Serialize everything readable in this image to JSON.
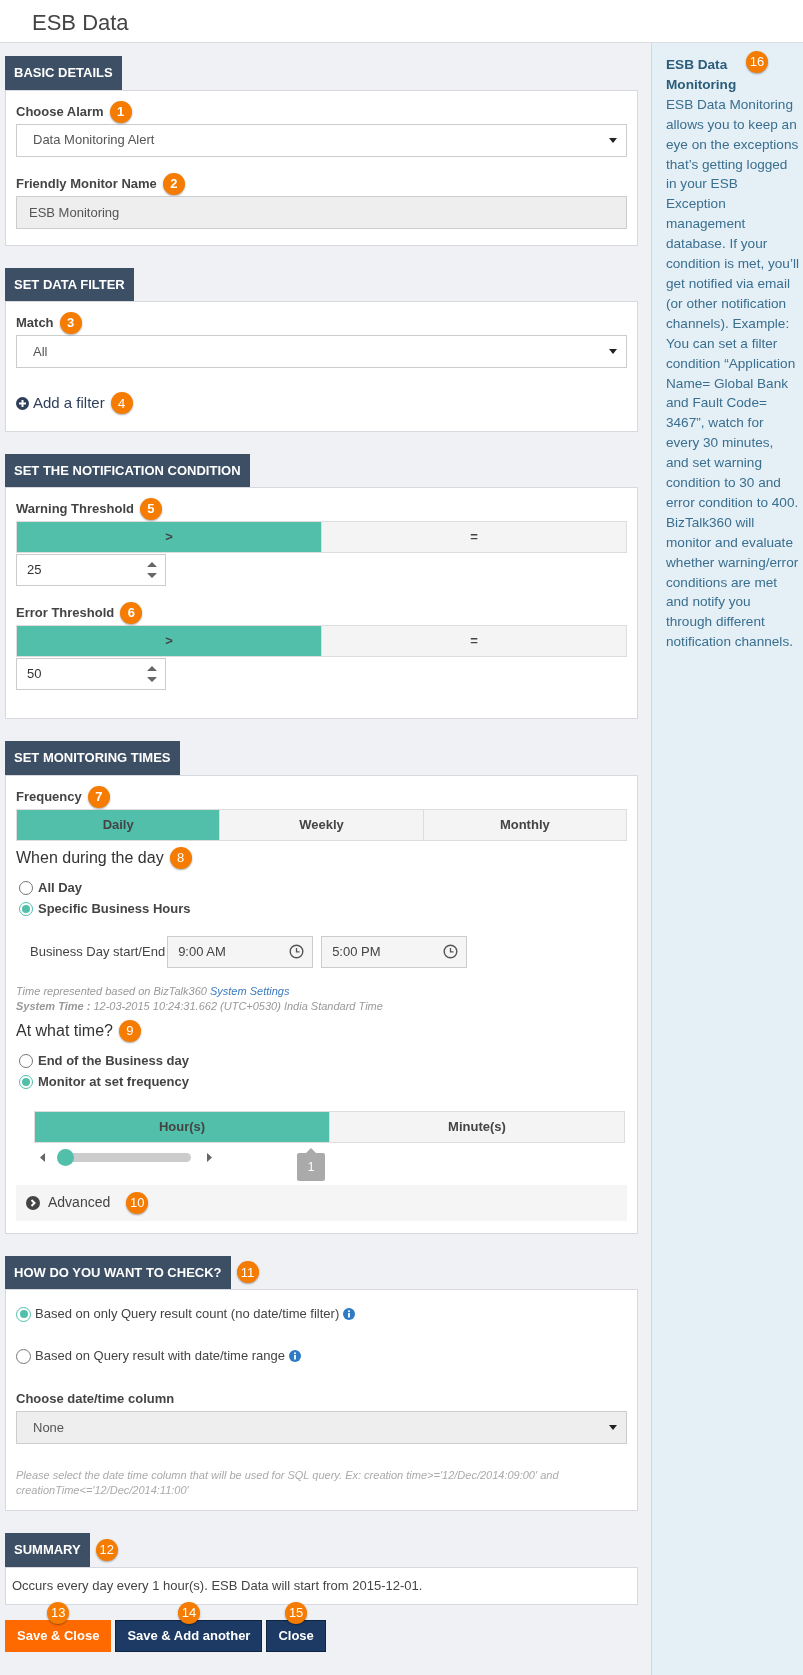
{
  "header": {
    "title": "ESB Data"
  },
  "sections": [
    {
      "title": "BASIC DETAILS",
      "items": [
        {
          "kind": "select",
          "label": "Choose Alarm",
          "badge": "1",
          "value": "Data Monitoring Alert",
          "disabled": false
        },
        {
          "kind": "input",
          "label": "Friendly Monitor Name",
          "badge": "2",
          "value": "ESB Monitoring",
          "disabled": true
        }
      ]
    },
    {
      "title": "SET DATA FILTER",
      "items": [
        {
          "kind": "select",
          "label": "Match",
          "badge": "3",
          "value": "All",
          "disabled": false
        },
        {
          "kind": "link",
          "label": "Add a filter",
          "badge": "4"
        }
      ]
    },
    {
      "title": "SET THE NOTIFICATION CONDITION",
      "items": [
        {
          "kind": "threshold",
          "label": "Warning Threshold",
          "badge": "5",
          "options": [
            {
              "label": ">",
              "selected": true
            },
            {
              "label": "=",
              "selected": false
            }
          ],
          "value": "25"
        },
        {
          "kind": "threshold",
          "label": "Error Threshold",
          "badge": "6",
          "options": [
            {
              "label": ">",
              "selected": true
            },
            {
              "label": "=",
              "selected": false
            }
          ],
          "value": "50"
        }
      ]
    },
    {
      "title": "SET MONITORING TIMES",
      "items": [
        {
          "kind": "segmented",
          "label": "Frequency",
          "badge": "7",
          "options": [
            {
              "label": "Daily",
              "selected": true
            },
            {
              "label": "Weekly",
              "selected": false
            },
            {
              "label": "Monthly",
              "selected": false
            }
          ]
        },
        {
          "kind": "radios",
          "heading": "When during the day",
          "badge": "8",
          "options": [
            {
              "label": "All Day",
              "selected": false
            },
            {
              "label": "Specific Business Hours",
              "selected": true
            }
          ]
        },
        {
          "kind": "timerange",
          "label": "Business Day start/End",
          "start": "9:00 AM",
          "end": "5:00 PM"
        },
        {
          "kind": "note",
          "text": "Time represented based on BizTalk360 ",
          "link": "System Settings",
          "line2": "**System Time :** 12-03-2015 10:24:31.662 (UTC+0530) India Standard Time"
        },
        {
          "kind": "radios",
          "heading": "At what time?",
          "badge": "9",
          "options": [
            {
              "label": "End of the Business day",
              "selected": false
            },
            {
              "label": "Monitor at set frequency",
              "selected": true
            }
          ]
        },
        {
          "kind": "interval",
          "options": [
            {
              "label": "Hour(s)",
              "selected": true
            },
            {
              "label": "Minute(s)",
              "selected": false
            }
          ],
          "level": 0,
          "value": "1"
        },
        {
          "kind": "advanced",
          "label": "Advanced",
          "badge": "10",
          "expanded": false
        }
      ]
    },
    {
      "title": "HOW DO YOU WANT TO CHECK?",
      "badge": "11",
      "items": [
        {
          "kind": "checkradios",
          "options": [
            {
              "label": "Based on only Query result count (no date/time filter)",
              "selected": true
            },
            {
              "label": "Based on Query result with date/time range",
              "selected": false
            }
          ]
        },
        {
          "kind": "select",
          "label": "Choose date/time column",
          "value": "None",
          "disabled": true
        },
        {
          "kind": "hint",
          "text": "Please select the date time column that will be used for SQL query. Ex: creation time>='12/Dec/2014:09:00' and creationTime<='12/Dec/2014:11:00'"
        }
      ]
    },
    {
      "title": "SUMMARY",
      "badge": "12",
      "items": [
        {
          "kind": "text",
          "text": "Occurs every day every 1 hour(s). ESB Data will start from 2015-12-01."
        }
      ]
    }
  ],
  "buttons": [
    {
      "label": "Save & Close",
      "badge": "13",
      "kind": "primary"
    },
    {
      "label": "Save & Add another",
      "badge": "14",
      "kind": "secondary"
    },
    {
      "label": "Close",
      "badge": "15",
      "kind": "secondary"
    }
  ],
  "sidebar": {
    "title": "ESB Data Monitoring",
    "badge": "16",
    "text": "ESB Data Monitoring allows you to keep an eye on the exceptions that’s getting logged in your ESB Exception management database. If your condition is met, you’ll get notified via email (or other notification channels). Example: You can set a filter condition “Application Name= Global Bank and Fault Code= 3467”, watch for every 30 minutes, and set warning condition to 30 and error condition to 400. BizTalk360 will monitor and evaluate whether warning/error conditions are met and notify you through different notification channels."
  }
}
